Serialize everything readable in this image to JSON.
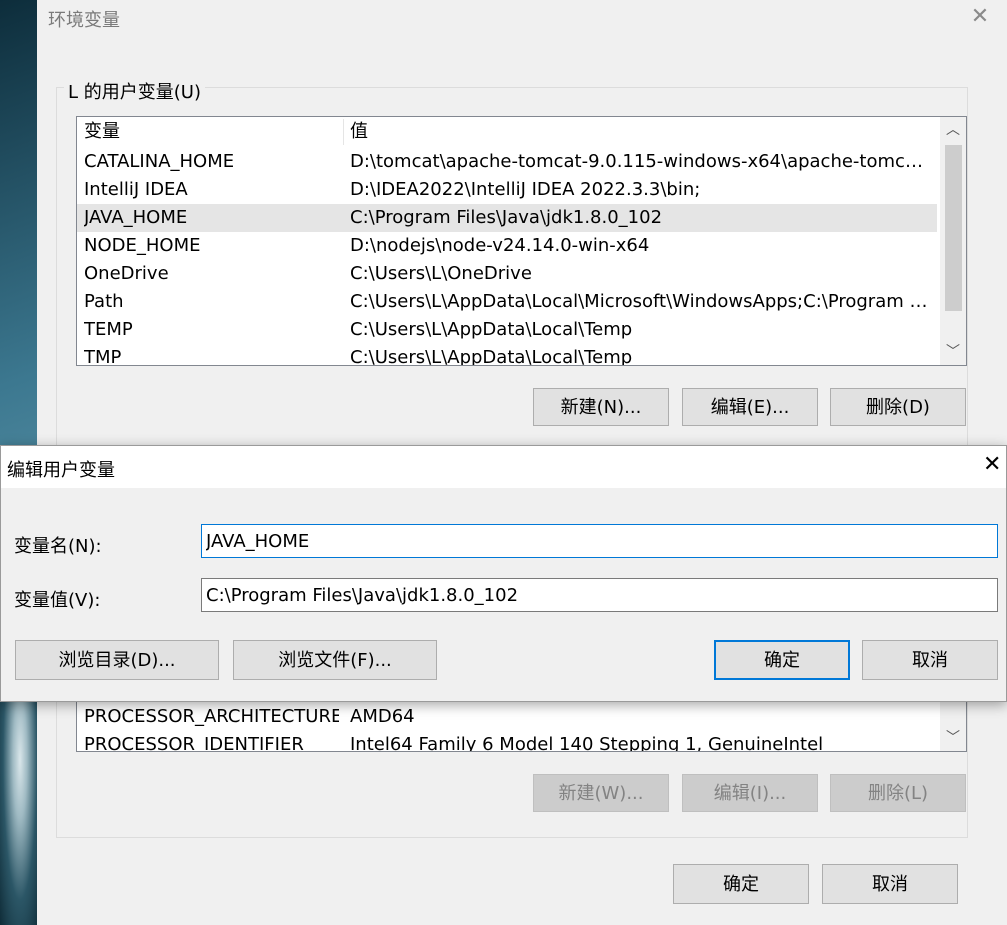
{
  "env_window": {
    "title": "环境变量",
    "user_group_label": "L 的用户变量(U)",
    "columns": {
      "variable": "变量",
      "value": "值"
    },
    "user_vars": [
      {
        "name": "CATALINA_HOME",
        "value": "D:\\tomcat\\apache-tomcat-9.0.115-windows-x64\\apache-tomcat-..."
      },
      {
        "name": "IntelliJ IDEA",
        "value": "D:\\IDEA2022\\IntelliJ IDEA 2022.3.3\\bin;"
      },
      {
        "name": "JAVA_HOME",
        "value": "C:\\Program Files\\Java\\jdk1.8.0_102",
        "selected": true
      },
      {
        "name": "NODE_HOME",
        "value": "D:\\nodejs\\node-v24.14.0-win-x64"
      },
      {
        "name": "OneDrive",
        "value": "C:\\Users\\L\\OneDrive"
      },
      {
        "name": "Path",
        "value": "C:\\Users\\L\\AppData\\Local\\Microsoft\\WindowsApps;C:\\Program Fil..."
      },
      {
        "name": "TEMP",
        "value": "C:\\Users\\L\\AppData\\Local\\Temp"
      },
      {
        "name": "TMP",
        "value": "C:\\Users\\L\\AppData\\Local\\Temp"
      }
    ],
    "user_buttons": {
      "new": "新建(N)...",
      "edit": "编辑(E)...",
      "delete": "删除(D)"
    },
    "system_vars": [
      {
        "name": "PROCESSOR_ARCHITECTURE",
        "value": "AMD64"
      },
      {
        "name": "PROCESSOR_IDENTIFIER",
        "value": "Intel64 Family 6 Model 140 Stepping 1, GenuineIntel"
      }
    ],
    "system_buttons": {
      "new": "新建(W)...",
      "edit": "编辑(I)...",
      "delete": "删除(L)"
    },
    "ok": "确定",
    "cancel": "取消",
    "close_glyph": "✕"
  },
  "edit_dialog": {
    "title": "编辑用户变量",
    "name_label": "变量名(N):",
    "name_value": "JAVA_HOME",
    "value_label": "变量值(V):",
    "value_value": "C:\\Program Files\\Java\\jdk1.8.0_102",
    "browse_dir": "浏览目录(D)...",
    "browse_file": "浏览文件(F)...",
    "ok": "确定",
    "cancel": "取消",
    "close_glyph": "✕"
  },
  "scroll_glyphs": {
    "up": "︿",
    "down": "﹀"
  }
}
